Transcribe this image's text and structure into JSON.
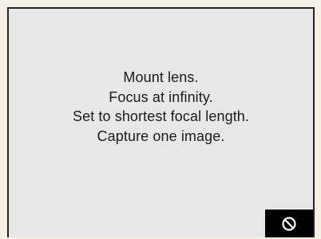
{
  "dialog": {
    "lines": [
      "Mount lens.",
      "Focus at infinity.",
      "Set to shortest focal length.",
      "Capture one image."
    ]
  },
  "controls": {
    "cancel_icon": "no-entry-icon",
    "background_color": "#e7e7e7",
    "button_color": "#000000"
  }
}
